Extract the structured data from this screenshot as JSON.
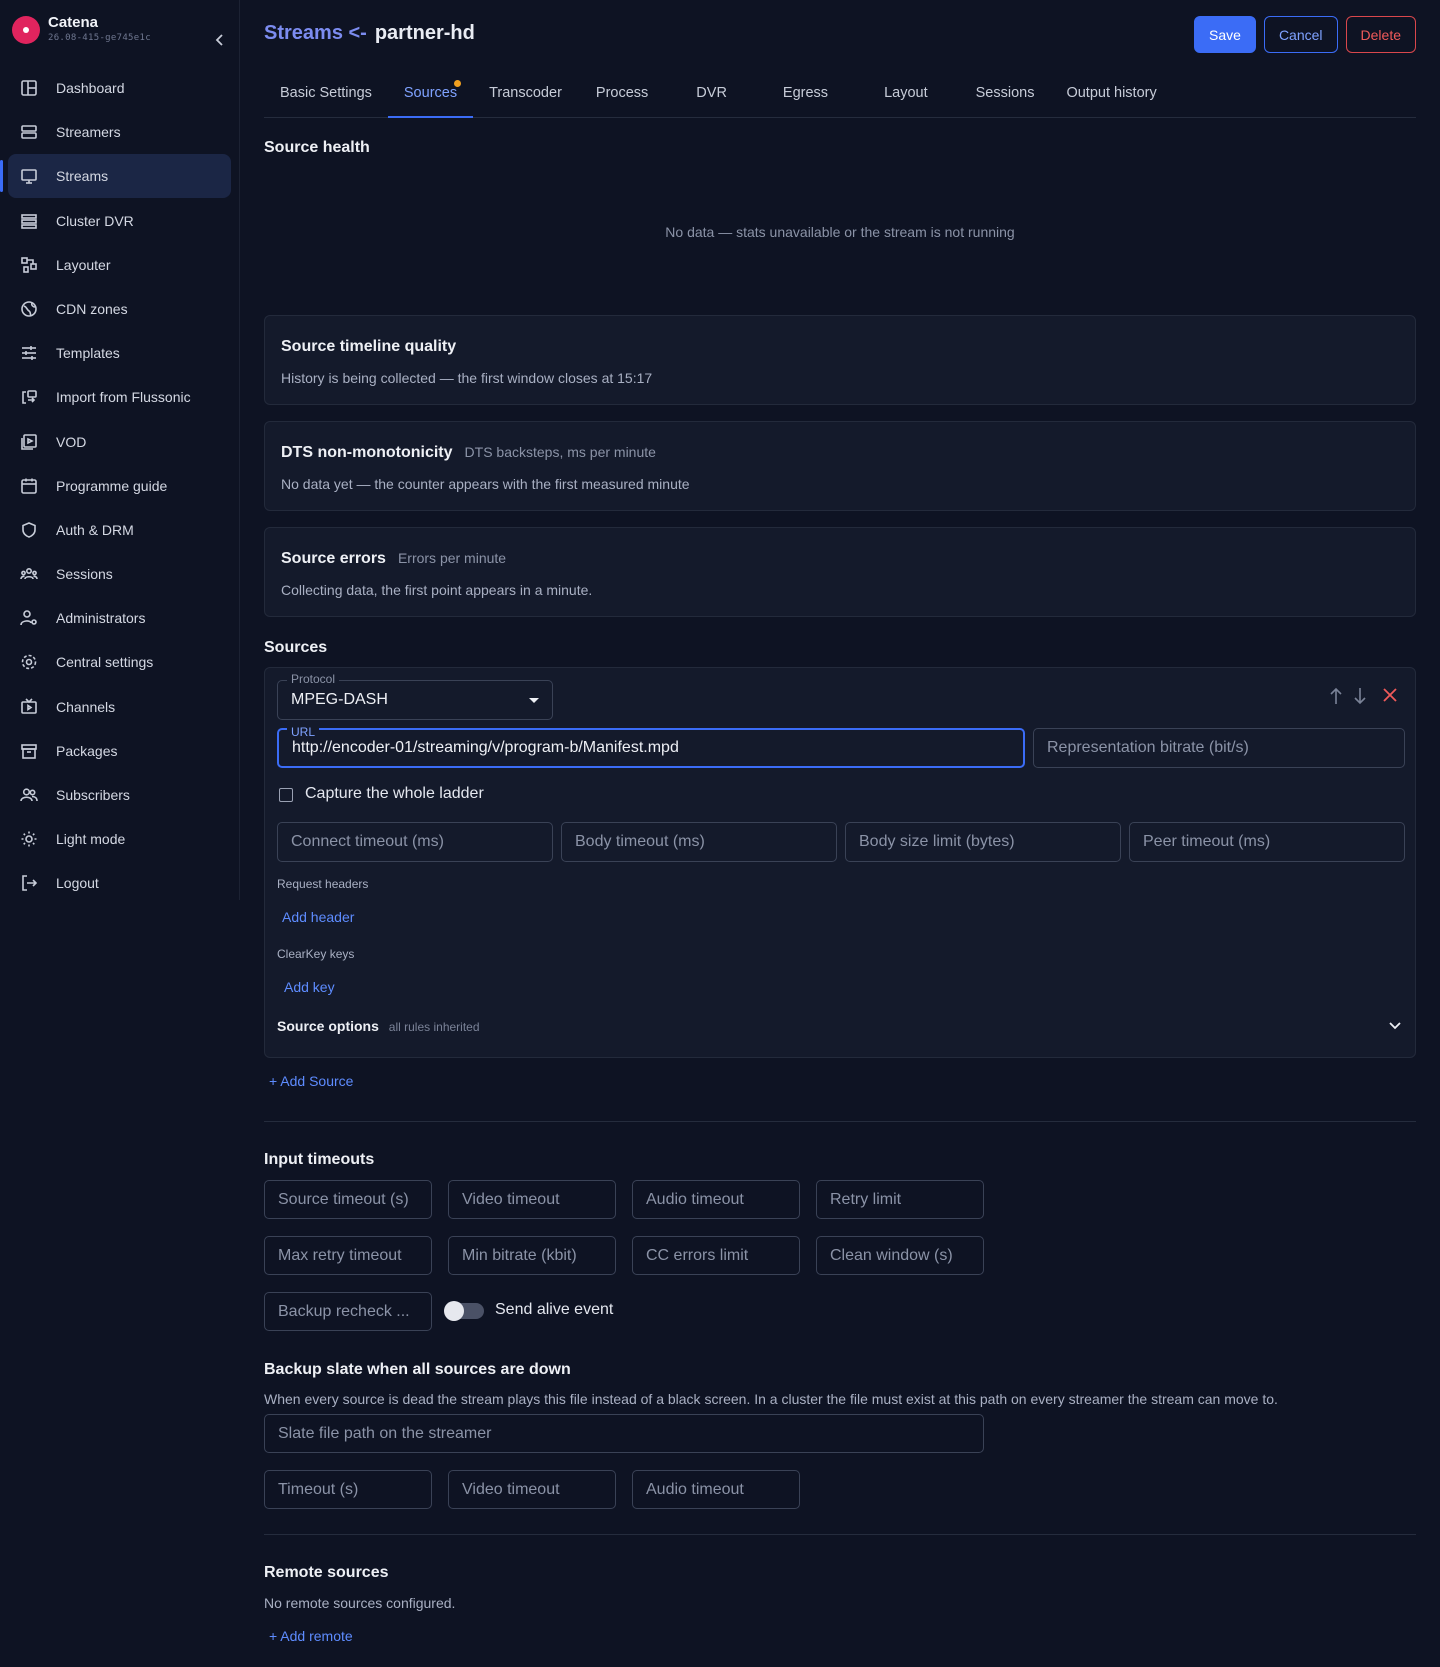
{
  "app": {
    "name": "Catena",
    "version": "26.08-415-ge745e1c"
  },
  "sidebar": {
    "items": [
      {
        "label": "Dashboard",
        "icon": "dashboard-icon"
      },
      {
        "label": "Streamers",
        "icon": "server-icon"
      },
      {
        "label": "Streams",
        "icon": "monitor-icon",
        "active": true
      },
      {
        "label": "Cluster DVR",
        "icon": "database-icon"
      },
      {
        "label": "Layouter",
        "icon": "layout-icon"
      },
      {
        "label": "CDN zones",
        "icon": "globe-icon"
      },
      {
        "label": "Templates",
        "icon": "sliders-icon"
      },
      {
        "label": "Import from Flussonic",
        "icon": "import-icon"
      },
      {
        "label": "VOD",
        "icon": "video-icon"
      },
      {
        "label": "Programme guide",
        "icon": "calendar-icon"
      },
      {
        "label": "Auth & DRM",
        "icon": "shield-icon"
      },
      {
        "label": "Sessions",
        "icon": "users-group-icon"
      },
      {
        "label": "Administrators",
        "icon": "user-gear-icon"
      },
      {
        "label": "Central settings",
        "icon": "gear-icon"
      },
      {
        "label": "Channels",
        "icon": "tv-icon"
      },
      {
        "label": "Packages",
        "icon": "package-icon"
      },
      {
        "label": "Subscribers",
        "icon": "users-icon"
      },
      {
        "label": "Light mode",
        "icon": "sun-icon"
      },
      {
        "label": "Logout",
        "icon": "logout-icon"
      }
    ]
  },
  "header": {
    "crumb": "Streams <-",
    "stream_name": "partner-hd",
    "save": "Save",
    "cancel": "Cancel",
    "delete": "Delete"
  },
  "tabs": [
    "Basic Settings",
    "Sources",
    "Transcoder",
    "Process",
    "DVR",
    "Egress",
    "Layout",
    "Sessions",
    "Output history"
  ],
  "active_tab": "Sources",
  "source_health": {
    "title": "Source health",
    "empty": "No data — stats unavailable or the stream is not running"
  },
  "timeline_quality": {
    "title": "Source timeline quality",
    "text": "History is being collected — the first window closes at 15:17"
  },
  "dts": {
    "title": "DTS non-monotonicity",
    "subtitle": "DTS backsteps, ms per minute",
    "text": "No data yet — the counter appears with the first measured minute"
  },
  "source_errors": {
    "title": "Source errors",
    "subtitle": "Errors per minute",
    "text": "Collecting data, the first point appears in a minute."
  },
  "sources": {
    "title": "Sources",
    "protocol_label": "Protocol",
    "protocol_value": "MPEG-DASH",
    "url_label": "URL",
    "url_value": "http://encoder-01/streaming/v/program-b/Manifest.mpd",
    "bitrate_placeholder": "Representation bitrate (bit/s)",
    "capture_ladder": "Capture the whole ladder",
    "connect_timeout": "Connect timeout (ms)",
    "body_timeout": "Body timeout (ms)",
    "body_size_limit": "Body size limit (bytes)",
    "peer_timeout": "Peer timeout (ms)",
    "request_headers": "Request headers",
    "add_header": "Add header",
    "clearkey_keys": "ClearKey keys",
    "add_key": "Add key",
    "source_options": "Source options",
    "source_options_hint": "all rules inherited",
    "add_source": "+ Add Source"
  },
  "input_timeouts": {
    "title": "Input timeouts",
    "fields": [
      "Source timeout (s)",
      "Video timeout",
      "Audio timeout",
      "Retry limit",
      "Max retry timeout",
      "Min bitrate (kbit)",
      "CC errors limit",
      "Clean window (s)"
    ],
    "backup_recheck": "Backup recheck ...",
    "send_alive_event": "Send alive event"
  },
  "backup_slate": {
    "title": "Backup slate when all sources are down",
    "description": "When every source is dead the stream plays this file instead of a black screen. In a cluster the file must exist at this path on every streamer the stream can move to.",
    "path_placeholder": "Slate file path on the streamer",
    "timeout": "Timeout (s)",
    "video_timeout": "Video timeout",
    "audio_timeout": "Audio timeout"
  },
  "remote_sources": {
    "title": "Remote sources",
    "empty": "No remote sources configured.",
    "add_remote": "+ Add remote"
  },
  "colors": {
    "accent": "#3b6cf6",
    "danger": "#d9474c",
    "background": "#0e1323",
    "card": "#141a2b",
    "tab_dot": "#f0a020",
    "brand": "#e0245e"
  }
}
